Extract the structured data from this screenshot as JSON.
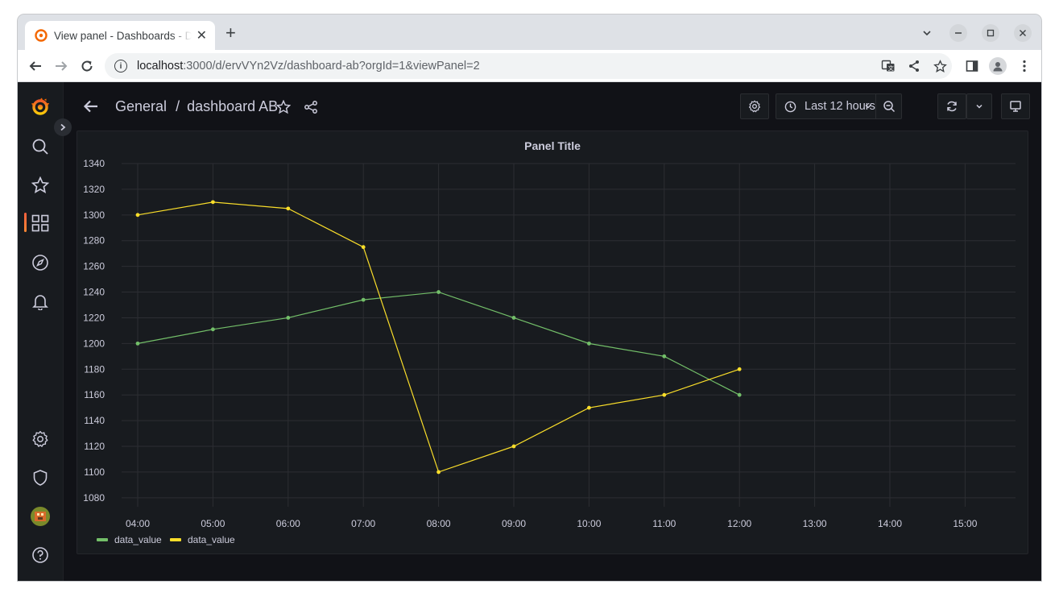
{
  "browser": {
    "tab_title": "View panel - Dashboards - Dashboards",
    "tab_close": "✕",
    "new_tab": "+",
    "url_host": "localhost",
    "url_rest": ":3000/d/ervVYn2Vz/dashboard-ab?orgId=1&viewPanel=2"
  },
  "header": {
    "breadcrumb_folder": "General",
    "breadcrumb_sep": "/",
    "breadcrumb_dashboard": "dashboard AB",
    "time_range": "Last 12 hours"
  },
  "panel": {
    "title": "Panel Title"
  },
  "chart_data": {
    "type": "line",
    "title": "Panel Title",
    "x": [
      "04:00",
      "05:00",
      "06:00",
      "07:00",
      "08:00",
      "09:00",
      "10:00",
      "11:00",
      "12:00"
    ],
    "x_ticks": [
      "04:00",
      "05:00",
      "06:00",
      "07:00",
      "08:00",
      "09:00",
      "10:00",
      "11:00",
      "12:00",
      "13:00",
      "14:00",
      "15:00"
    ],
    "y_ticks": [
      1080,
      1100,
      1120,
      1140,
      1160,
      1180,
      1200,
      1220,
      1240,
      1260,
      1280,
      1300,
      1320,
      1340
    ],
    "ylim": [
      1073,
      1340
    ],
    "grid": true,
    "legend_position": "bottom-left",
    "series": [
      {
        "name": "data_value",
        "color": "#73bf69",
        "values": [
          1200,
          1211,
          1220,
          1234,
          1240,
          1220,
          1200,
          1190,
          1160
        ]
      },
      {
        "name": "data_value",
        "color": "#fade2a",
        "values": [
          1300,
          1310,
          1305,
          1275,
          1100,
          1120,
          1150,
          1160,
          1180
        ]
      }
    ]
  }
}
